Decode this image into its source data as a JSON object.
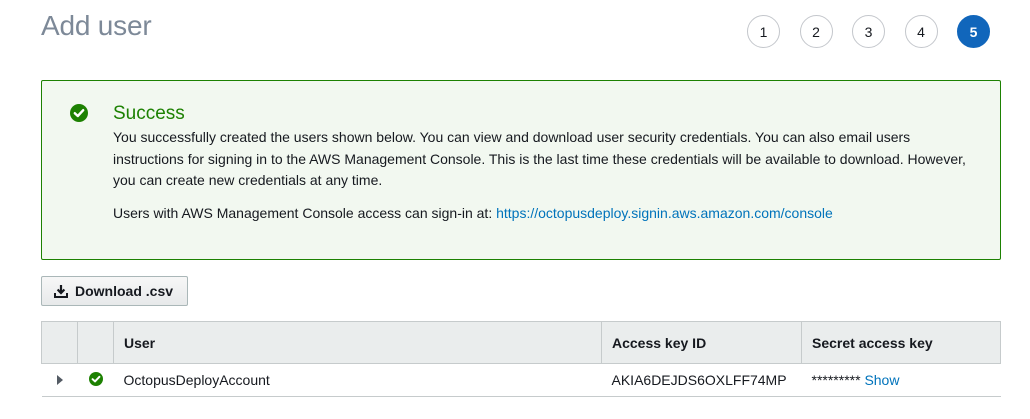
{
  "page": {
    "title": "Add user"
  },
  "steps": [
    "1",
    "2",
    "3",
    "4",
    "5"
  ],
  "current_step": "5",
  "alert": {
    "title": "Success",
    "body": "You successfully created the users shown below. You can view and download user security credentials. You can also email users instructions for signing in to the AWS Management Console. This is the last time these credentials will be available to download. However, you can create new credentials at any time.",
    "signin_text": "Users with AWS Management Console access can sign-in at:",
    "signin_url": "https://octopusdeploy.signin.aws.amazon.com/console",
    "color": "#1d8102"
  },
  "toolbar": {
    "download_label": "Download .csv"
  },
  "table": {
    "columns": {
      "user": "User",
      "access_key": "Access key ID",
      "secret": "Secret access key"
    },
    "rows": [
      {
        "user": "OctopusDeployAccount",
        "access_key": "AKIA6DEJDS6OXLFF74MP",
        "secret_masked": "*********",
        "show_label": "Show"
      }
    ]
  },
  "colors": {
    "accent": "#1166bb",
    "link": "#0073bb",
    "success": "#1d8102"
  }
}
